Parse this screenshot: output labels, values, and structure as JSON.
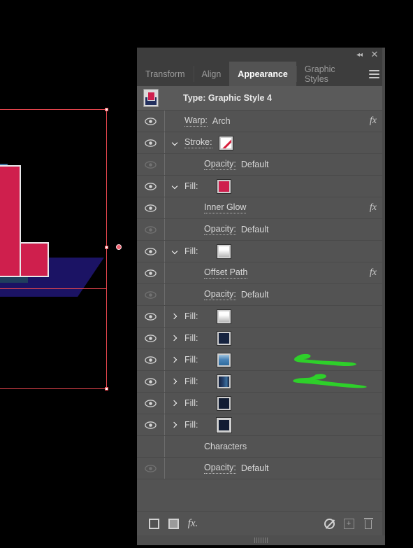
{
  "window": {
    "collapse_icon": "double-chevron-left-icon",
    "close_icon": "close-icon",
    "menu_icon": "hamburger-menu-icon"
  },
  "tabs": [
    {
      "label": "Transform",
      "active": false
    },
    {
      "label": "Align",
      "active": false
    },
    {
      "label": "Appearance",
      "active": true
    },
    {
      "label": "Graphic Styles",
      "active": false
    }
  ],
  "header": {
    "title": "Type: Graphic Style 4",
    "thumbnail": "artwork-thumbnail"
  },
  "rows": [
    {
      "label": "Warp:",
      "value": "Arch",
      "indent": "top",
      "eye": true,
      "eye_dim": false,
      "disclosure": "none",
      "swatch": null,
      "fx": true,
      "dotted": true
    },
    {
      "label": "Stroke:",
      "value": "",
      "indent": "top",
      "eye": true,
      "eye_dim": false,
      "disclosure": "down",
      "swatch": "none",
      "fx": false,
      "dotted": true
    },
    {
      "label": "Opacity:",
      "value": "Default",
      "indent": "sub",
      "eye": true,
      "eye_dim": true,
      "disclosure": "none",
      "swatch": null,
      "fx": false,
      "dotted": true
    },
    {
      "label": "Fill:",
      "value": "",
      "indent": "top",
      "eye": true,
      "eye_dim": false,
      "disclosure": "down",
      "swatch": "crimson",
      "fx": false,
      "dotted": false
    },
    {
      "label": "Inner Glow",
      "value": "",
      "indent": "sub",
      "eye": true,
      "eye_dim": false,
      "disclosure": "none",
      "swatch": null,
      "fx": true,
      "dotted": true
    },
    {
      "label": "Opacity:",
      "value": "Default",
      "indent": "sub",
      "eye": true,
      "eye_dim": true,
      "disclosure": "none",
      "swatch": null,
      "fx": false,
      "dotted": true
    },
    {
      "label": "Fill:",
      "value": "",
      "indent": "top",
      "eye": true,
      "eye_dim": false,
      "disclosure": "down",
      "swatch": "white-gray-gradient",
      "fx": false,
      "dotted": false
    },
    {
      "label": "Offset Path",
      "value": "",
      "indent": "sub",
      "eye": true,
      "eye_dim": false,
      "disclosure": "none",
      "swatch": null,
      "fx": true,
      "dotted": true
    },
    {
      "label": "Opacity:",
      "value": "Default",
      "indent": "sub",
      "eye": true,
      "eye_dim": true,
      "disclosure": "none",
      "swatch": null,
      "fx": false,
      "dotted": true
    },
    {
      "label": "Fill:",
      "value": "",
      "indent": "top",
      "eye": true,
      "eye_dim": false,
      "disclosure": "right",
      "swatch": "white-gray-gradient",
      "fx": false,
      "dotted": false
    },
    {
      "label": "Fill:",
      "value": "",
      "indent": "top",
      "eye": true,
      "eye_dim": false,
      "disclosure": "right",
      "swatch": "navy-solid",
      "fx": false,
      "dotted": false
    },
    {
      "label": "Fill:",
      "value": "",
      "indent": "top",
      "eye": true,
      "eye_dim": false,
      "disclosure": "right",
      "swatch": "blue-gradient",
      "fx": false,
      "dotted": false,
      "mark": "green-stroke-1"
    },
    {
      "label": "Fill:",
      "value": "",
      "indent": "top",
      "eye": true,
      "eye_dim": false,
      "disclosure": "right",
      "swatch": "navy-blue-gradient",
      "fx": false,
      "dotted": false,
      "mark": "green-stroke-2"
    },
    {
      "label": "Fill:",
      "value": "",
      "indent": "top",
      "eye": true,
      "eye_dim": false,
      "disclosure": "right",
      "swatch": "dark-navy-solid",
      "fx": false,
      "dotted": false
    },
    {
      "label": "Fill:",
      "value": "",
      "indent": "top",
      "eye": true,
      "eye_dim": false,
      "disclosure": "right",
      "swatch": "dark-navy-outlined",
      "fx": false,
      "dotted": false
    },
    {
      "label": "Characters",
      "value": "",
      "indent": "chars",
      "eye": false,
      "eye_dim": false,
      "disclosure": "none",
      "swatch": null,
      "fx": false,
      "dotted": false
    },
    {
      "label": "Opacity:",
      "value": "Default",
      "indent": "sub",
      "eye": true,
      "eye_dim": true,
      "disclosure": "none",
      "swatch": null,
      "fx": false,
      "dotted": true
    }
  ],
  "footer": {
    "buttons": [
      {
        "name": "add-new-stroke-button",
        "icon": "square-outline-icon"
      },
      {
        "name": "add-new-fill-button",
        "icon": "square-filled-icon"
      },
      {
        "name": "add-new-effect-button",
        "icon": "fx-icon"
      },
      {
        "name": "clear-appearance-button",
        "icon": "no-symbol-icon"
      },
      {
        "name": "duplicate-selected-item-button",
        "icon": "plus-square-icon"
      },
      {
        "name": "delete-selected-item-button",
        "icon": "trash-icon"
      }
    ]
  },
  "colors": {
    "panel_bg": "#535353",
    "panel_header_bg": "#3d3d3d",
    "row_divider": "#4a4a4a",
    "text": "#d9d9d9",
    "active_tab_text": "#ffffff",
    "inactive_tab_text": "#9a9a9a",
    "swatch_crimson": "#cf1f4d",
    "swatch_navy": "#18264a",
    "swatch_blue": "#4a84b8",
    "annotation_green": "#2ed02a",
    "selection_red": "#e8464e",
    "canvas_bg": "#000000"
  },
  "artwork": {
    "description": "3D extruded letter L artwork",
    "face_color": "#cf1f4d",
    "side_color": "#2b5c86",
    "shadow_color": "#1b1364",
    "outline_color": "#e8e8ea"
  }
}
